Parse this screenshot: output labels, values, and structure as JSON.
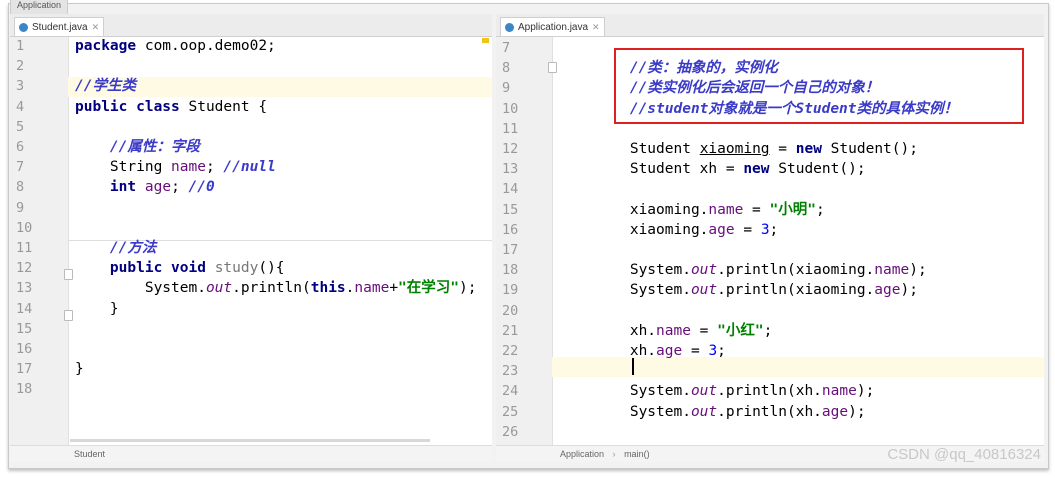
{
  "window": {
    "app_tab": "Application"
  },
  "left": {
    "tab_label": "Student.java",
    "status_crumb": "Student",
    "lines": [
      {
        "n": "1",
        "html": "<span class='kw'>package</span> com.oop.demo02;"
      },
      {
        "n": "2",
        "html": ""
      },
      {
        "n": "3",
        "html": "<span class='cmb'>//学生类</span>"
      },
      {
        "n": "4",
        "html": "<span class='kw'>public class</span> Student {"
      },
      {
        "n": "5",
        "html": ""
      },
      {
        "n": "6",
        "html": "    <span class='cmb'>//属性：字段</span>"
      },
      {
        "n": "7",
        "html": "    String <span class='fld'>name</span>; <span class='cmb'>//null</span>"
      },
      {
        "n": "8",
        "html": "    <span class='kw'>int</span> <span class='fld'>age</span>; <span class='cmb'>//0</span>"
      },
      {
        "n": "9",
        "html": ""
      },
      {
        "n": "10",
        "html": ""
      },
      {
        "n": "11",
        "html": "    <span class='cmb'>//方法</span>"
      },
      {
        "n": "12",
        "html": "    <span class='kw'>public void</span> <span class='mth'>study</span>(){"
      },
      {
        "n": "13",
        "html": "        System.<span class='fldi'>out</span>.println(<span class='kw'>this</span>.<span class='fld'>name</span>+<span class='str'>\"在学习\"</span>);"
      },
      {
        "n": "14",
        "html": "    }"
      },
      {
        "n": "15",
        "html": ""
      },
      {
        "n": "16",
        "html": ""
      },
      {
        "n": "17",
        "html": "}"
      },
      {
        "n": "18",
        "html": ""
      }
    ]
  },
  "right": {
    "tab_label": "Application.java",
    "status_crumb": "Application",
    "status_crumb2": "main()",
    "lines": [
      {
        "n": "7",
        "html": ""
      },
      {
        "n": "8",
        "html": "        <span class='cmb'>//类：抽象的，实例化</span>"
      },
      {
        "n": "9",
        "html": "        <span class='cmb'>//类实例化后会返回一个自己的对象！</span>"
      },
      {
        "n": "10",
        "html": "        <span class='cmb'>//student对象就是一个Student类的具体实例！</span>"
      },
      {
        "n": "11",
        "html": ""
      },
      {
        "n": "12",
        "html": "        Student <span class='sub'>xiaoming</span> = <span class='kw'>new</span> Student();"
      },
      {
        "n": "13",
        "html": "        Student xh = <span class='kw'>new</span> Student();"
      },
      {
        "n": "14",
        "html": ""
      },
      {
        "n": "15",
        "html": "        xiaoming.<span class='fld'>name</span> = <span class='str'>\"小明\"</span>;"
      },
      {
        "n": "16",
        "html": "        xiaoming.<span class='fld'>age</span> = <span class='num'>3</span>;"
      },
      {
        "n": "17",
        "html": ""
      },
      {
        "n": "18",
        "html": "        System.<span class='fldi'>out</span>.println(xiaoming.<span class='fld'>name</span>);"
      },
      {
        "n": "19",
        "html": "        System.<span class='fldi'>out</span>.println(xiaoming.<span class='fld'>age</span>);"
      },
      {
        "n": "20",
        "html": ""
      },
      {
        "n": "21",
        "html": "        xh.<span class='fld'>name</span> = <span class='str'>\"小红\"</span>;"
      },
      {
        "n": "22",
        "html": "        xh.<span class='fld'>age</span> = <span class='num'>3</span>;"
      },
      {
        "n": "23",
        "html": ""
      },
      {
        "n": "24",
        "html": "        System.<span class='fldi'>out</span>.println(xh.<span class='fld'>name</span>);"
      },
      {
        "n": "25",
        "html": "        System.<span class='fldi'>out</span>.println(xh.<span class='fld'>age</span>);"
      },
      {
        "n": "26",
        "html": ""
      }
    ]
  },
  "watermark": "CSDN @qq_40816324"
}
